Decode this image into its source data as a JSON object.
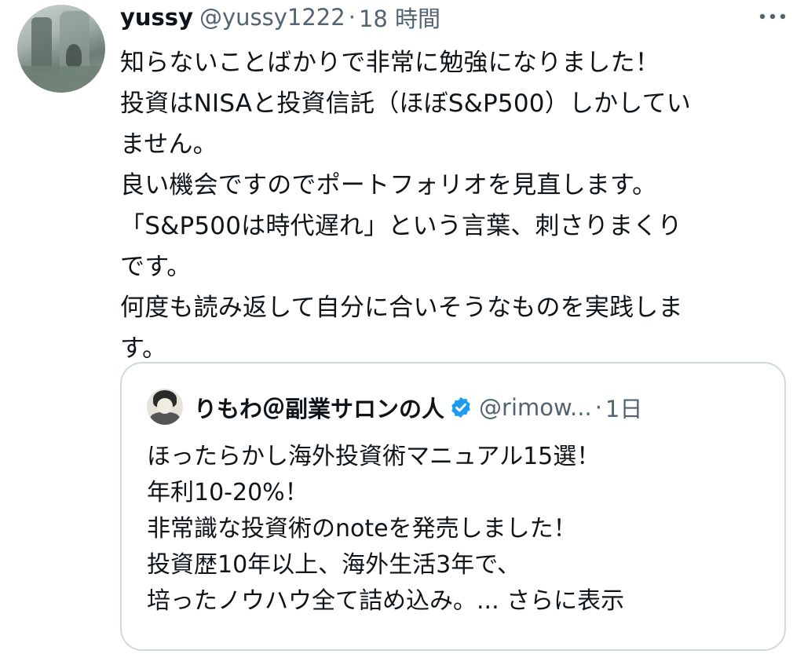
{
  "tweet": {
    "display_name": "yussy",
    "handle": "@yussy1222",
    "separator": "·",
    "time": "18 時間",
    "body_lines": [
      "知らないことばかりで非常に勉強になりました！",
      "投資はNISAと投資信託（ほぼS&P500）しかしてい",
      "ません。",
      "良い機会ですのでポートフォリオを見直します。",
      "「S&P500は時代遅れ」という言葉、刺さりまくり",
      "です。",
      "何度も読み返して自分に合いそうなものを実践しま",
      "す。"
    ],
    "more_icon": "more-horizontal-icon"
  },
  "quote": {
    "display_name": "りもわ＠副業サロンの人",
    "verified_icon": "verified-badge-icon",
    "verified_color": "#1d9bf0",
    "handle": "@rimow...",
    "separator": "·",
    "time": "1日",
    "body_lines": [
      "ほったらかし海外投資術マニュアル15選！",
      "年利10-20%！",
      "非常識な投資術のnoteを発売しました！",
      "投資歴10年以上、海外生活3年で、"
    ],
    "last_line": "培ったノウハウ全て詰め込み。...",
    "show_more": "さらに表示"
  },
  "colors": {
    "text_primary": "#0f1419",
    "text_secondary": "#536471",
    "border": "#cfd9de"
  }
}
